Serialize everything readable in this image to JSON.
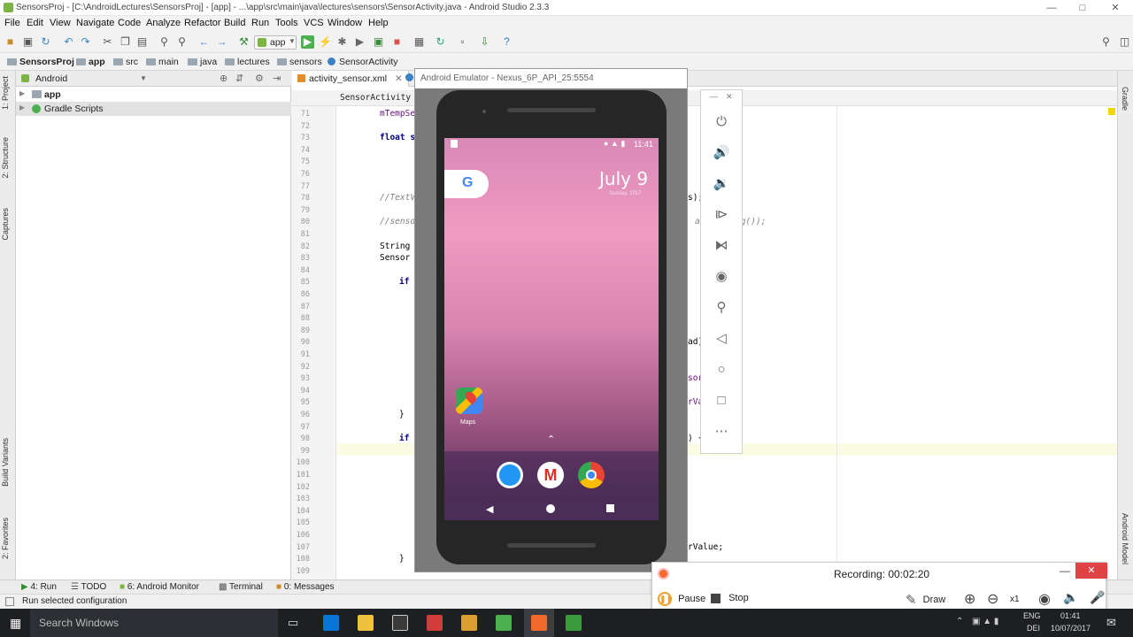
{
  "window": {
    "title": "SensorsProj - [C:\\AndroidLectures\\SensorsProj] - [app] - ...\\app\\src\\main\\java\\lectures\\sensors\\SensorActivity.java - Android Studio 2.3.3"
  },
  "menu": [
    "File",
    "Edit",
    "View",
    "Navigate",
    "Code",
    "Analyze",
    "Refactor",
    "Build",
    "Run",
    "Tools",
    "VCS",
    "Window",
    "Help"
  ],
  "toolbar": {
    "run_config": "app"
  },
  "breadcrumbs": [
    "SensorsProj",
    "app",
    "src",
    "main",
    "java",
    "lectures",
    "sensors",
    "SensorActivity"
  ],
  "left_tools": [
    "1: Project",
    "2: Structure",
    "Captures",
    "Build Variants",
    "2: Favorites"
  ],
  "right_tools": [
    "Gradle",
    "Android Model"
  ],
  "project": {
    "view_selector": "Android",
    "tree": [
      {
        "label": "app"
      },
      {
        "label": "Gradle Scripts"
      }
    ]
  },
  "editor": {
    "tabs": [
      "activity_sensor.xml"
    ],
    "subtab": "SensorActivity",
    "line_numbers": [
      "71",
      "72",
      "73",
      "74",
      "75",
      "76",
      "77",
      "78",
      "79",
      "80",
      "81",
      "82",
      "83",
      "84",
      "85",
      "86",
      "87",
      "88",
      "89",
      "90",
      "91",
      "92",
      "93",
      "94",
      "95",
      "96",
      "97",
      "98",
      "99",
      "100",
      "101",
      "102",
      "103",
      "104",
      "105",
      "106",
      "107",
      "108",
      "109"
    ],
    "code": [
      {
        "line": "71",
        "text": "mTempSe",
        "kind": "fd",
        "indent": 1
      },
      {
        "line": "73",
        "text": "float s",
        "kind": "kw",
        "indent": 1
      },
      {
        "line": "78",
        "text": "//TextV",
        "kind": "cm",
        "indent": 1
      },
      {
        "line": "80",
        "text": "//senso",
        "kind": "cm",
        "indent": 1
      },
      {
        "line": "82",
        "text": "String",
        "kind": "plain",
        "indent": 1
      },
      {
        "line": "83",
        "text": "Sensor",
        "kind": "plain",
        "indent": 1
      },
      {
        "line": "85",
        "text": "if",
        "kind": "kw",
        "indent": 2
      },
      {
        "line": "96",
        "text": "}",
        "kind": "plain",
        "indent": 2
      },
      {
        "line": "98",
        "text": "if (",
        "kind": "kw",
        "indent": 2
      },
      {
        "line": "108",
        "text": "}",
        "kind": "plain",
        "indent": 2
      }
    ],
    "code_right": [
      {
        "line": "78",
        "text": "s);"
      },
      {
        "line": "80",
        "text": "alu",
        "kind": "cm"
      },
      {
        "line": "80b",
        "text": "ng());",
        "kind": "cm"
      },
      {
        "line": "90",
        "text": "ad)"
      },
      {
        "line": "94",
        "text": "sor"
      },
      {
        "line": "96",
        "text": "rVa"
      },
      {
        "line": "98",
        "text": ") {"
      },
      {
        "line": "107",
        "text": "rValue;"
      }
    ]
  },
  "emulator": {
    "title": "Android Emulator - Nexus_6P_API_25:5554",
    "status_time": "11:41",
    "date": "July 9",
    "weather": "Sunday, 2017",
    "maps_label": "Maps"
  },
  "bottom_tools": [
    "4: Run",
    "TODO",
    "6: Android Monitor",
    "Terminal",
    "0: Messages"
  ],
  "status": {
    "message": "Run selected configuration"
  },
  "recording": {
    "status": "Recording:  00:02:20",
    "pause": "Pause",
    "stop": "Stop",
    "draw": "Draw",
    "zoom": "x1"
  },
  "taskbar": {
    "search_placeholder": "Search Windows",
    "lang": "ENG",
    "region": "DEI",
    "time": "01:41",
    "date": "10/07/2017"
  },
  "colors": {
    "accent": "#4caf50",
    "close": "#e04343",
    "taskbar": "#1d1f22"
  }
}
